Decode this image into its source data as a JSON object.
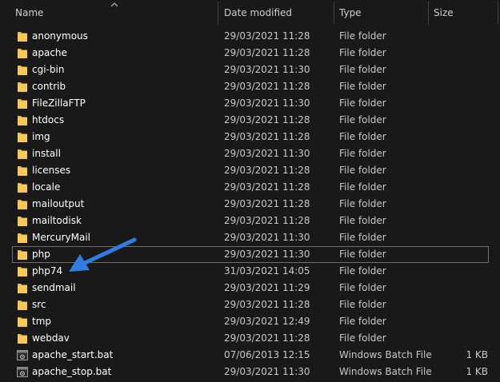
{
  "columns": {
    "name": "Name",
    "date_modified": "Date modified",
    "type": "Type",
    "size": "Size"
  },
  "files": [
    {
      "name": "anonymous",
      "date": "29/03/2021 11:28",
      "type": "File folder",
      "size": "",
      "icon": "folder-icon"
    },
    {
      "name": "apache",
      "date": "29/03/2021 11:28",
      "type": "File folder",
      "size": "",
      "icon": "folder-icon"
    },
    {
      "name": "cgi-bin",
      "date": "29/03/2021 11:30",
      "type": "File folder",
      "size": "",
      "icon": "folder-icon"
    },
    {
      "name": "contrib",
      "date": "29/03/2021 11:28",
      "type": "File folder",
      "size": "",
      "icon": "folder-icon"
    },
    {
      "name": "FileZillaFTP",
      "date": "29/03/2021 11:30",
      "type": "File folder",
      "size": "",
      "icon": "folder-icon"
    },
    {
      "name": "htdocs",
      "date": "29/03/2021 11:28",
      "type": "File folder",
      "size": "",
      "icon": "folder-icon"
    },
    {
      "name": "img",
      "date": "29/03/2021 11:28",
      "type": "File folder",
      "size": "",
      "icon": "folder-icon"
    },
    {
      "name": "install",
      "date": "29/03/2021 11:30",
      "type": "File folder",
      "size": "",
      "icon": "folder-icon"
    },
    {
      "name": "licenses",
      "date": "29/03/2021 11:28",
      "type": "File folder",
      "size": "",
      "icon": "folder-icon"
    },
    {
      "name": "locale",
      "date": "29/03/2021 11:28",
      "type": "File folder",
      "size": "",
      "icon": "folder-icon"
    },
    {
      "name": "mailoutput",
      "date": "29/03/2021 11:28",
      "type": "File folder",
      "size": "",
      "icon": "folder-icon"
    },
    {
      "name": "mailtodisk",
      "date": "29/03/2021 11:28",
      "type": "File folder",
      "size": "",
      "icon": "folder-icon"
    },
    {
      "name": "MercuryMail",
      "date": "29/03/2021 11:30",
      "type": "File folder",
      "size": "",
      "icon": "folder-icon"
    },
    {
      "name": "php",
      "date": "29/03/2021 11:30",
      "type": "File folder",
      "size": "",
      "icon": "folder-icon"
    },
    {
      "name": "php74",
      "date": "31/03/2021 14:05",
      "type": "File folder",
      "size": "",
      "icon": "folder-icon"
    },
    {
      "name": "sendmail",
      "date": "29/03/2021 11:29",
      "type": "File folder",
      "size": "",
      "icon": "folder-icon"
    },
    {
      "name": "src",
      "date": "29/03/2021 11:28",
      "type": "File folder",
      "size": "",
      "icon": "folder-icon"
    },
    {
      "name": "tmp",
      "date": "29/03/2021 12:49",
      "type": "File folder",
      "size": "",
      "icon": "folder-icon"
    },
    {
      "name": "webdav",
      "date": "29/03/2021 11:28",
      "type": "File folder",
      "size": "",
      "icon": "folder-icon"
    },
    {
      "name": "apache_start.bat",
      "date": "07/06/2013 12:15",
      "type": "Windows Batch File",
      "size": "1 KB",
      "icon": "batch-file-icon"
    },
    {
      "name": "apache_stop.bat",
      "date": "29/03/2021 11:30",
      "type": "Windows Batch File",
      "size": "1 KB",
      "icon": "batch-file-icon"
    }
  ],
  "focused_item": "php",
  "colors": {
    "background": "#191919",
    "folder": "#f6c957",
    "arrow": "#2f7de1",
    "focus_border": "#6d6d6d"
  }
}
